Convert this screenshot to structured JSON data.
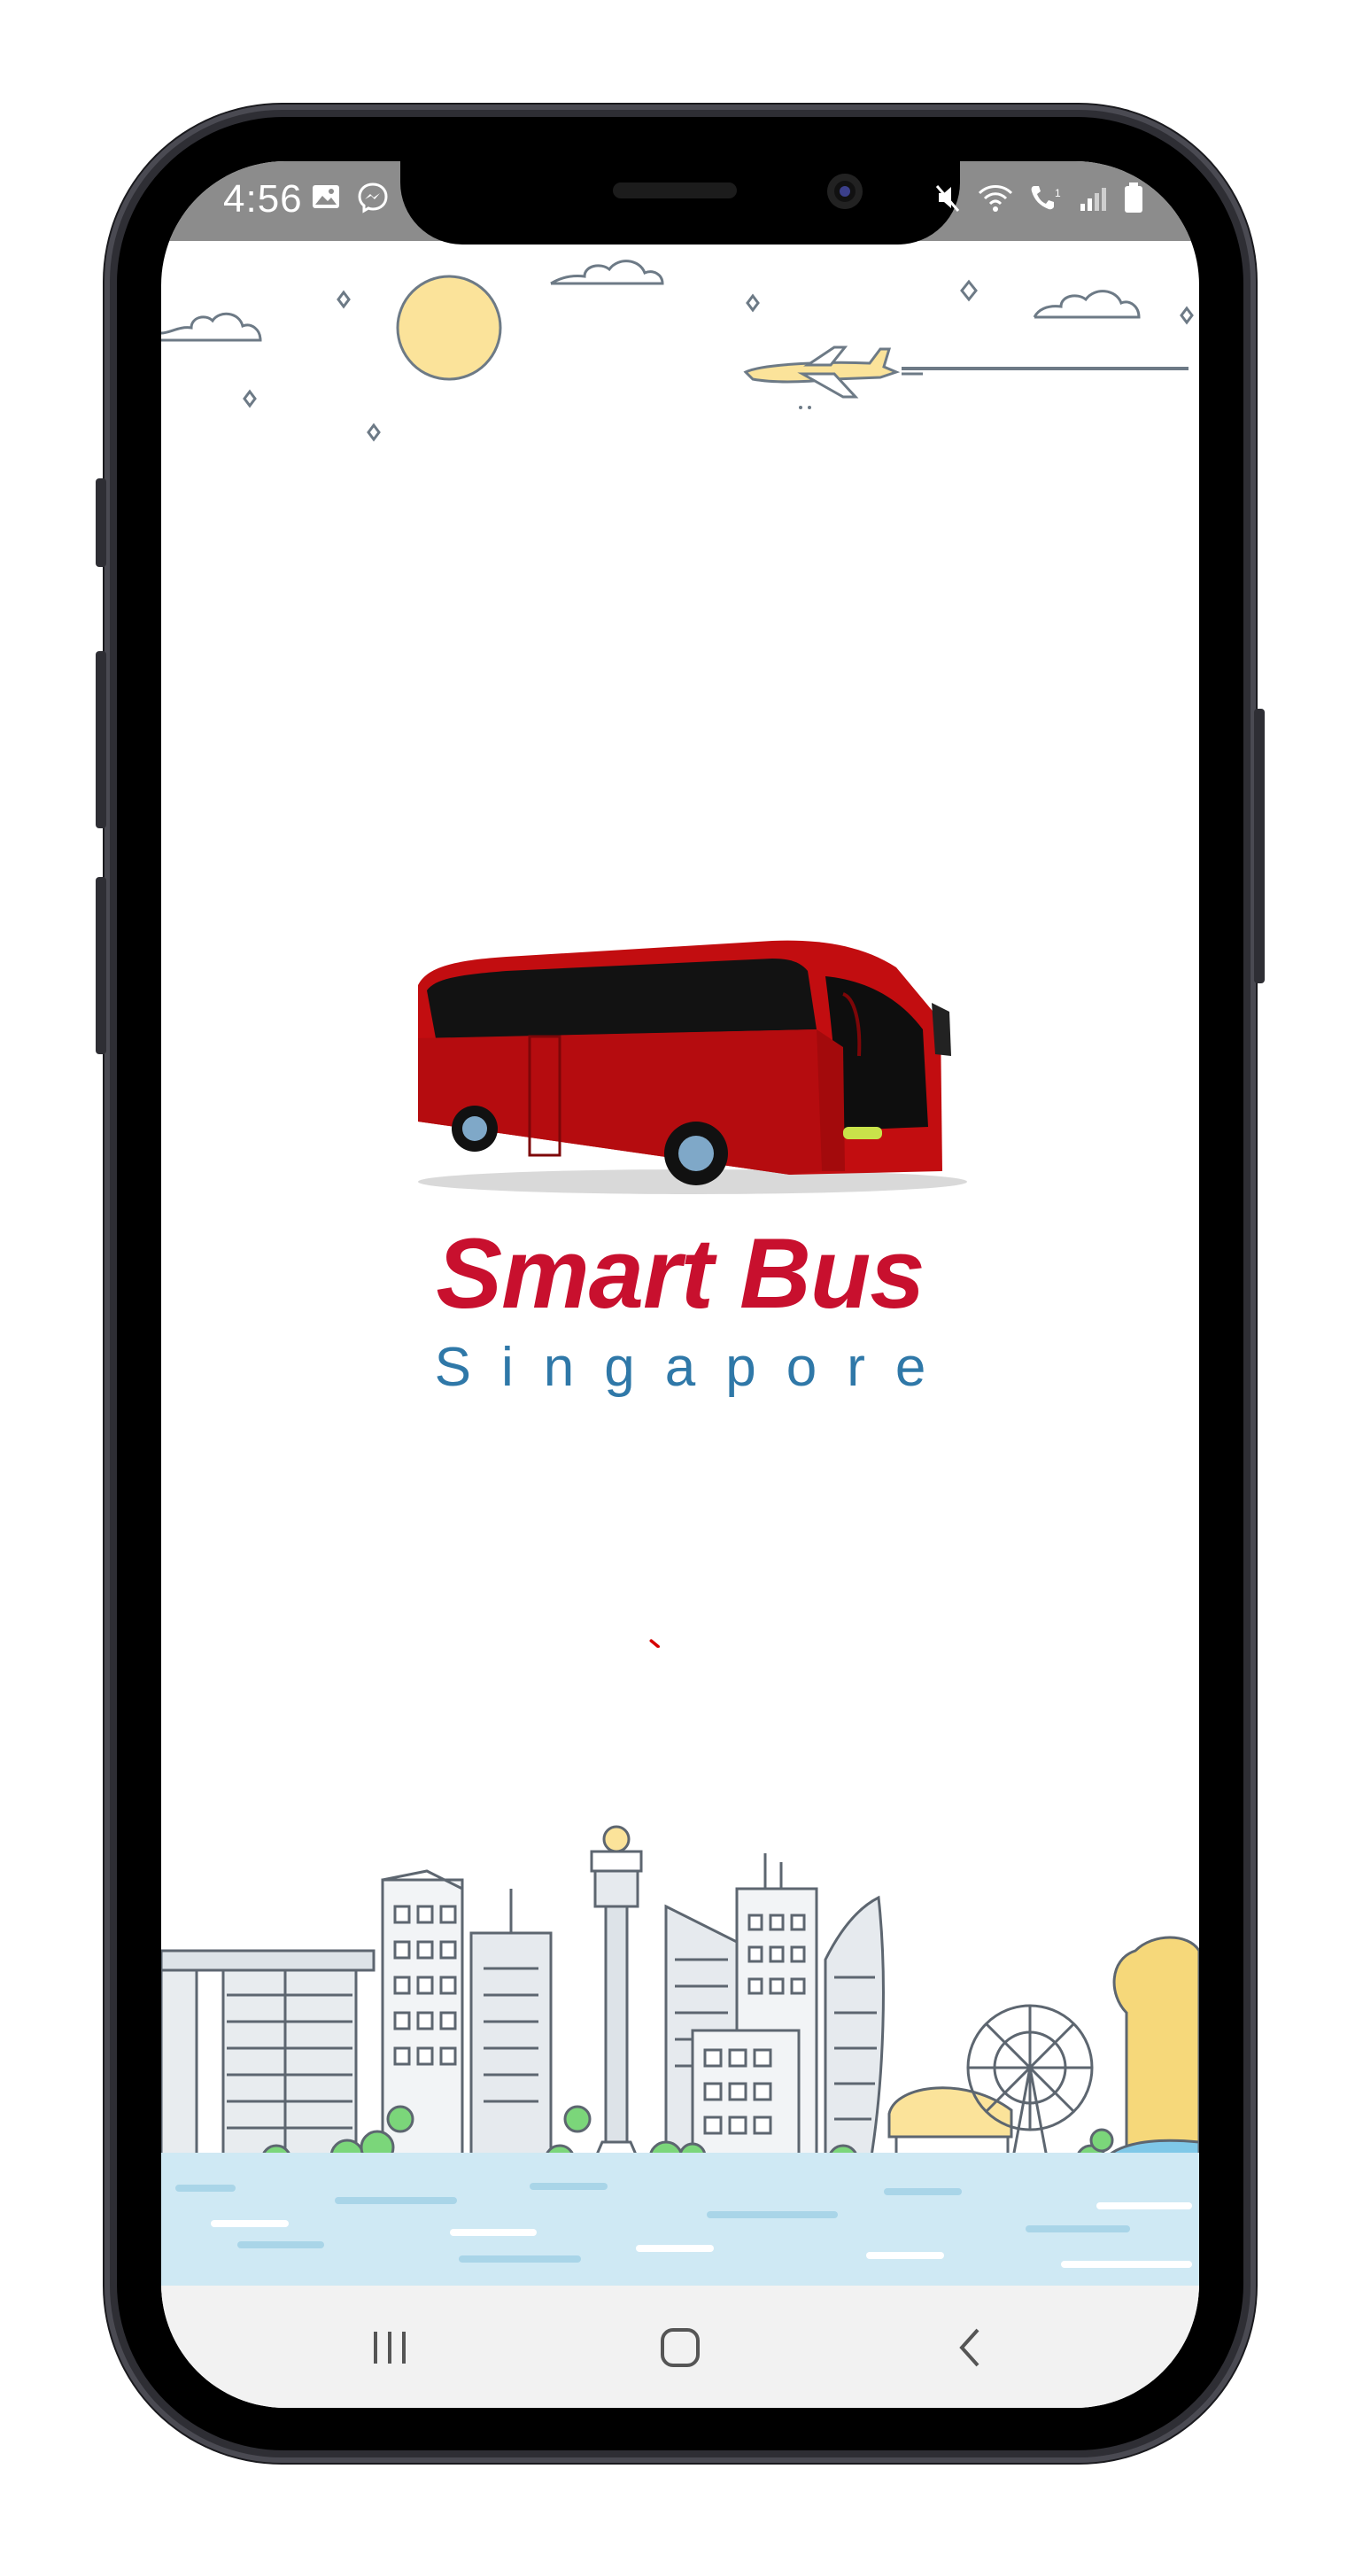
{
  "status_bar": {
    "time": "4:56",
    "left_icons": [
      "image-icon",
      "messenger-icon"
    ],
    "right_icons": [
      "mute-icon",
      "wifi-calling-icon",
      "volte-icon",
      "signal-icon",
      "battery-icon"
    ]
  },
  "splash": {
    "brand_title": "Smart Bus",
    "brand_subtitle": "Singapore",
    "illustration_top": "sky-with-sun-clouds-plane",
    "illustration_center": "red-coach-bus",
    "illustration_bottom": "singapore-skyline"
  },
  "loading": {
    "state": "loading"
  },
  "nav_bar": {
    "buttons": [
      "recents-button",
      "home-button",
      "back-button"
    ]
  },
  "colors": {
    "brand_red": "#c8102e",
    "brand_blue": "#2f78a8",
    "status_bar": "#8c8c8c",
    "water": "#cfe9f4"
  }
}
